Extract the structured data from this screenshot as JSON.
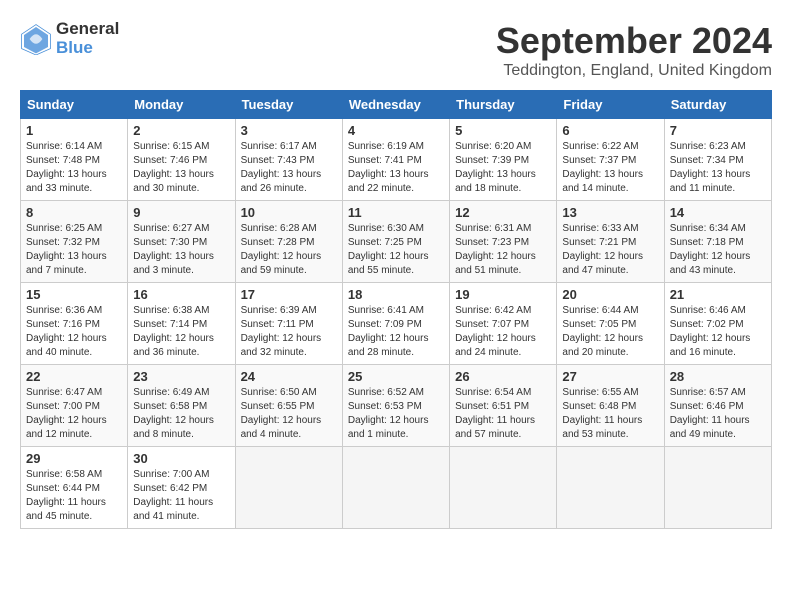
{
  "header": {
    "logo_line1": "General",
    "logo_line2": "Blue",
    "month": "September 2024",
    "location": "Teddington, England, United Kingdom"
  },
  "weekdays": [
    "Sunday",
    "Monday",
    "Tuesday",
    "Wednesday",
    "Thursday",
    "Friday",
    "Saturday"
  ],
  "weeks": [
    [
      {
        "num": "1",
        "sr": "6:14 AM",
        "ss": "7:48 PM",
        "dl": "13 hours and 33 minutes."
      },
      {
        "num": "2",
        "sr": "6:15 AM",
        "ss": "7:46 PM",
        "dl": "13 hours and 30 minutes."
      },
      {
        "num": "3",
        "sr": "6:17 AM",
        "ss": "7:43 PM",
        "dl": "13 hours and 26 minutes."
      },
      {
        "num": "4",
        "sr": "6:19 AM",
        "ss": "7:41 PM",
        "dl": "13 hours and 22 minutes."
      },
      {
        "num": "5",
        "sr": "6:20 AM",
        "ss": "7:39 PM",
        "dl": "13 hours and 18 minutes."
      },
      {
        "num": "6",
        "sr": "6:22 AM",
        "ss": "7:37 PM",
        "dl": "13 hours and 14 minutes."
      },
      {
        "num": "7",
        "sr": "6:23 AM",
        "ss": "7:34 PM",
        "dl": "13 hours and 11 minutes."
      }
    ],
    [
      {
        "num": "8",
        "sr": "6:25 AM",
        "ss": "7:32 PM",
        "dl": "13 hours and 7 minutes."
      },
      {
        "num": "9",
        "sr": "6:27 AM",
        "ss": "7:30 PM",
        "dl": "13 hours and 3 minutes."
      },
      {
        "num": "10",
        "sr": "6:28 AM",
        "ss": "7:28 PM",
        "dl": "12 hours and 59 minutes."
      },
      {
        "num": "11",
        "sr": "6:30 AM",
        "ss": "7:25 PM",
        "dl": "12 hours and 55 minutes."
      },
      {
        "num": "12",
        "sr": "6:31 AM",
        "ss": "7:23 PM",
        "dl": "12 hours and 51 minutes."
      },
      {
        "num": "13",
        "sr": "6:33 AM",
        "ss": "7:21 PM",
        "dl": "12 hours and 47 minutes."
      },
      {
        "num": "14",
        "sr": "6:34 AM",
        "ss": "7:18 PM",
        "dl": "12 hours and 43 minutes."
      }
    ],
    [
      {
        "num": "15",
        "sr": "6:36 AM",
        "ss": "7:16 PM",
        "dl": "12 hours and 40 minutes."
      },
      {
        "num": "16",
        "sr": "6:38 AM",
        "ss": "7:14 PM",
        "dl": "12 hours and 36 minutes."
      },
      {
        "num": "17",
        "sr": "6:39 AM",
        "ss": "7:11 PM",
        "dl": "12 hours and 32 minutes."
      },
      {
        "num": "18",
        "sr": "6:41 AM",
        "ss": "7:09 PM",
        "dl": "12 hours and 28 minutes."
      },
      {
        "num": "19",
        "sr": "6:42 AM",
        "ss": "7:07 PM",
        "dl": "12 hours and 24 minutes."
      },
      {
        "num": "20",
        "sr": "6:44 AM",
        "ss": "7:05 PM",
        "dl": "12 hours and 20 minutes."
      },
      {
        "num": "21",
        "sr": "6:46 AM",
        "ss": "7:02 PM",
        "dl": "12 hours and 16 minutes."
      }
    ],
    [
      {
        "num": "22",
        "sr": "6:47 AM",
        "ss": "7:00 PM",
        "dl": "12 hours and 12 minutes."
      },
      {
        "num": "23",
        "sr": "6:49 AM",
        "ss": "6:58 PM",
        "dl": "12 hours and 8 minutes."
      },
      {
        "num": "24",
        "sr": "6:50 AM",
        "ss": "6:55 PM",
        "dl": "12 hours and 4 minutes."
      },
      {
        "num": "25",
        "sr": "6:52 AM",
        "ss": "6:53 PM",
        "dl": "12 hours and 1 minute."
      },
      {
        "num": "26",
        "sr": "6:54 AM",
        "ss": "6:51 PM",
        "dl": "11 hours and 57 minutes."
      },
      {
        "num": "27",
        "sr": "6:55 AM",
        "ss": "6:48 PM",
        "dl": "11 hours and 53 minutes."
      },
      {
        "num": "28",
        "sr": "6:57 AM",
        "ss": "6:46 PM",
        "dl": "11 hours and 49 minutes."
      }
    ],
    [
      {
        "num": "29",
        "sr": "6:58 AM",
        "ss": "6:44 PM",
        "dl": "11 hours and 45 minutes."
      },
      {
        "num": "30",
        "sr": "7:00 AM",
        "ss": "6:42 PM",
        "dl": "11 hours and 41 minutes."
      },
      null,
      null,
      null,
      null,
      null
    ]
  ]
}
